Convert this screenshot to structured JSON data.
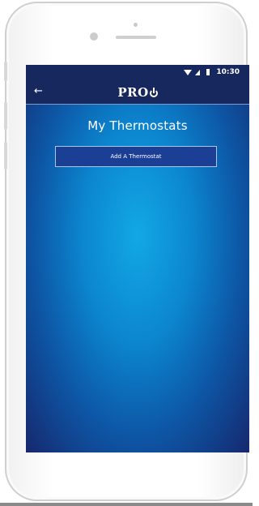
{
  "statusbar": {
    "time": "10:30",
    "icons": [
      "wifi-icon",
      "signal-icon",
      "battery-icon"
    ]
  },
  "appbar": {
    "back_icon": "←",
    "logo_text": "PRO",
    "logo_icon": "power-icon"
  },
  "main": {
    "title": "My Thermostats",
    "add_button_label": "Add A Thermostat"
  },
  "colors": {
    "statusbar_bg": "#16285d",
    "screen_center": "#12a8e6",
    "screen_edge": "#16286e",
    "button_bg": "#1a3f94",
    "button_border": "#a8c6f0"
  }
}
